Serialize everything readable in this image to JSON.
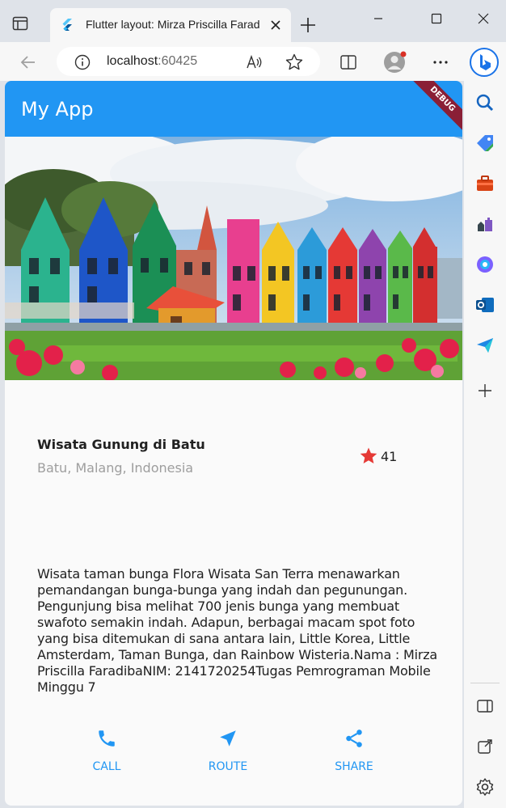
{
  "browser": {
    "tab_title": "Flutter layout: Mirza Priscilla Faradiba",
    "url_host": "localhost",
    "url_port": ":60425"
  },
  "app": {
    "title": "My App",
    "debug_banner": "DEBUG"
  },
  "place": {
    "name": "Wisata Gunung di Batu",
    "location": "Batu, Malang, Indonesia",
    "star_count": "41",
    "star_color": "#e53935"
  },
  "description": "Wisata taman bunga Flora Wisata San Terra menawarkan pemandangan bunga-bunga yang indah dan pegunungan. Pengunjung bisa melihat 700 jenis bunga yang membuat swafoto semakin indah. Adapun, berbagai macam spot foto yang bisa ditemukan di sana antara lain, Little Korea, Little Amsterdam, Taman Bunga, dan Rainbow Wisteria.Nama : Mirza Priscilla FaradibaNIM: 2141720254Tugas Pemrograman Mobile Minggu 7",
  "actions": {
    "call": "CALL",
    "route": "ROUTE",
    "share": "SHARE",
    "color": "#2196f3"
  },
  "icons": {
    "tab_actions": "tab-actions-icon",
    "favicon": "flutter-icon",
    "sidebar": [
      "search-icon",
      "tag-icon",
      "briefcase-icon",
      "chess-icon",
      "copilot-icon",
      "outlook-icon",
      "send-icon",
      "add-icon",
      "sidebar-toggle-icon",
      "external-link-icon",
      "gear-icon"
    ]
  }
}
